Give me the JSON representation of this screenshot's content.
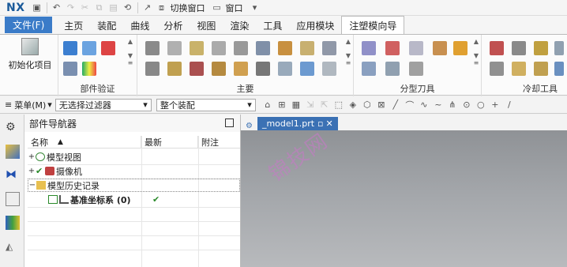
{
  "app": {
    "logo": "NX"
  },
  "quick_access": {
    "switch_window": "切换窗口",
    "window": "窗口"
  },
  "ribbon_tabs": {
    "file": "文件(F)",
    "tabs": [
      "主页",
      "装配",
      "曲线",
      "分析",
      "视图",
      "渲染",
      "工具",
      "应用模块",
      "注塑模向导"
    ],
    "active": "注塑模向导"
  },
  "ribbon": {
    "init_project": "初始化项目",
    "groups": {
      "part_validation": "部件验证",
      "main": "主要",
      "parting_tools": "分型刀具",
      "cooling_tools": "冷却工具"
    }
  },
  "command_bar": {
    "menu": "菜单(M)",
    "filter": "无选择过滤器",
    "scope": "整个装配"
  },
  "navigator": {
    "title": "部件导航器",
    "columns": {
      "name": "名称",
      "latest": "最新",
      "note": "附注"
    },
    "rows": [
      {
        "label": "模型视图"
      },
      {
        "label": "摄像机"
      },
      {
        "label": "模型历史记录"
      },
      {
        "label": "基准坐标系 (0)",
        "latest": "✔"
      }
    ]
  },
  "document": {
    "tab_label": "_model1.prt"
  },
  "watermark": "锦技网",
  "colors": {
    "accent": "#3a7bc8",
    "doc_tab": "#3b71b4",
    "check": "#2a8a2a"
  }
}
